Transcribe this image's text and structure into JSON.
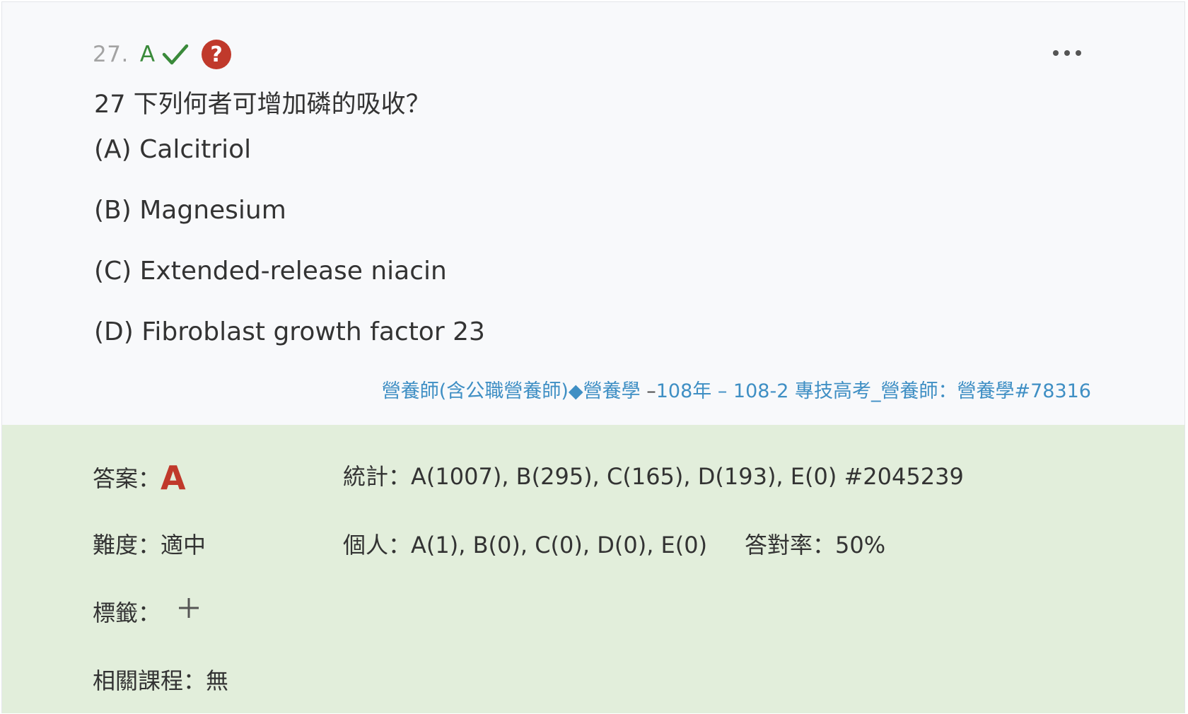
{
  "header": {
    "number": "27.",
    "user_answer": "A",
    "help_symbol": "?"
  },
  "question": {
    "text": "27 下列何者可增加磷的吸收？",
    "options": [
      "(A) Calcitriol",
      "(B) Magnesium",
      "(C) Extended-release niacin",
      "(D) Fibroblast growth factor 23"
    ]
  },
  "source": {
    "subject": "營養師(含公職營養師)◆營養學",
    "dash": " –",
    "exam": "108年 – 108-2 專技高考_營養師：營養學#78316"
  },
  "stats": {
    "answer_label": "答案：",
    "answer_value": "A",
    "difficulty_label": "難度：",
    "difficulty_value": "適中",
    "tags_label": "標籤：",
    "related_label": "相關課程：",
    "related_value": "無",
    "overall_label": "統計：",
    "overall_value": "A(1007), B(295), C(165), D(193), E(0) #2045239",
    "personal_label": "個人：",
    "personal_value": "A(1), B(0), C(0), D(0), E(0)",
    "rate_label": "答對率：",
    "rate_value": "50%"
  },
  "icons": {
    "check": "checkmark-icon",
    "help": "question-mark-icon",
    "more": "more-horizontal-icon",
    "add": "plus-icon"
  },
  "colors": {
    "correct_green": "#3a8a3a",
    "help_red": "#c0392b",
    "answer_red": "#c0392b",
    "link_blue": "#3f8fc4",
    "stats_bg": "#e2eedb"
  }
}
